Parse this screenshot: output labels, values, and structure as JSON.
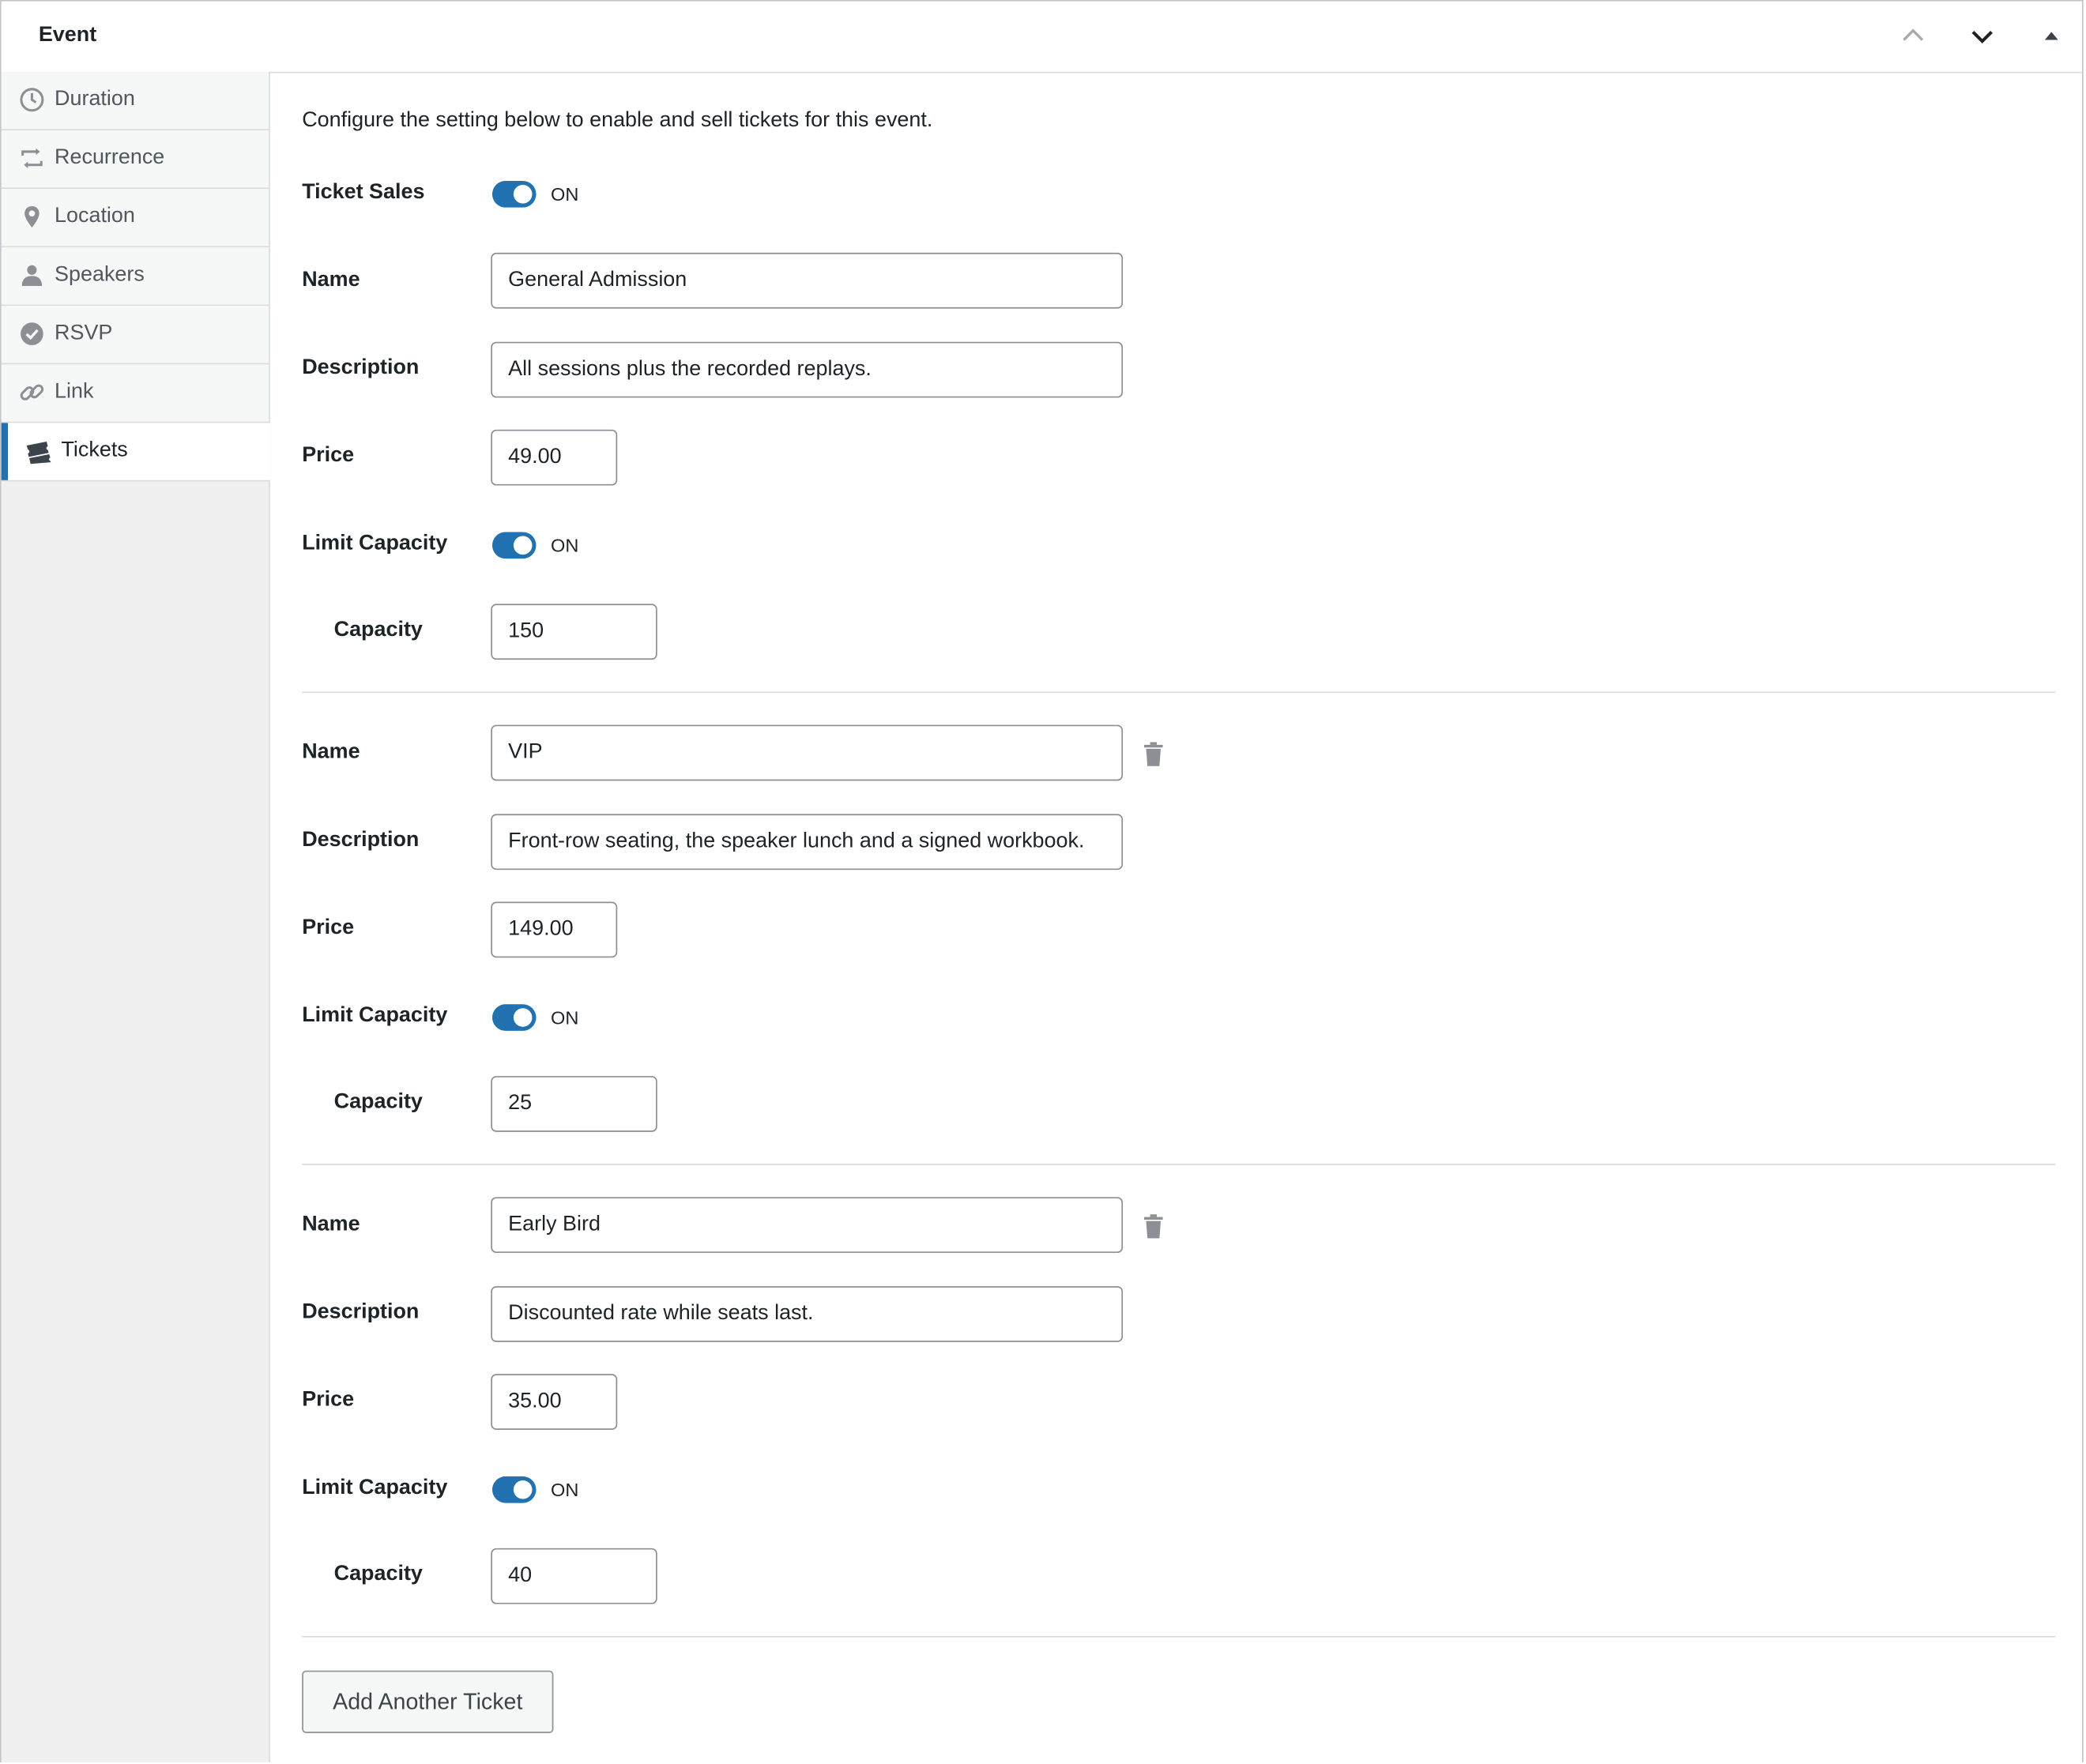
{
  "panel": {
    "title": "Event",
    "controls": [
      "move-up-icon",
      "move-down-icon",
      "collapse-triangle-icon"
    ]
  },
  "sidebar": {
    "items": [
      {
        "label": "Duration",
        "icon": "clock-icon"
      },
      {
        "label": "Recurrence",
        "icon": "repeat-icon"
      },
      {
        "label": "Location",
        "icon": "location-pin-icon"
      },
      {
        "label": "Speakers",
        "icon": "person-icon"
      },
      {
        "label": "RSVP",
        "icon": "checkmark-circle-icon"
      },
      {
        "label": "Link",
        "icon": "link-icon"
      },
      {
        "label": "Tickets",
        "icon": "tickets-icon",
        "active": true
      }
    ]
  },
  "main": {
    "intro": "Configure the setting below to enable and sell tickets for this event.",
    "ticket_sales": {
      "label": "Ticket Sales",
      "state": "ON",
      "enabled": true
    },
    "labels": {
      "name": "Name",
      "description": "Description",
      "price": "Price",
      "limit_capacity": "Limit Capacity",
      "capacity": "Capacity"
    },
    "tickets": [
      {
        "name": "General Admission",
        "description": "All sessions plus the recorded replays.",
        "price": "49.00",
        "limit_capacity_state": "ON",
        "capacity": "150",
        "deletable": false
      },
      {
        "name": "VIP",
        "description": "Front-row seating, the speaker lunch and a signed workbook.",
        "price": "149.00",
        "limit_capacity_state": "ON",
        "capacity": "25",
        "deletable": true
      },
      {
        "name": "Early Bird",
        "description": "Discounted rate while seats last.",
        "price": "35.00",
        "limit_capacity_state": "ON",
        "capacity": "40",
        "deletable": true
      }
    ],
    "add_button": "Add Another Ticket"
  },
  "colors": {
    "accent": "#2271b1",
    "border": "#8c8f94",
    "sidebar_bg": "#f0f0f1"
  }
}
